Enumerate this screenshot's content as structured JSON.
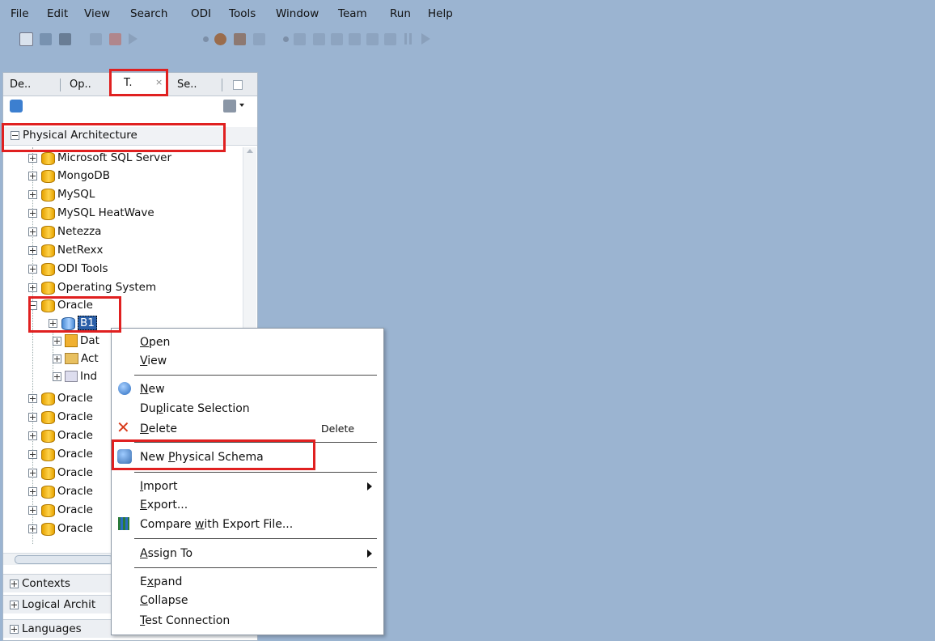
{
  "menubar": [
    "File",
    "Edit",
    "View",
    "Search",
    "ODI",
    "Tools",
    "Window",
    "Team",
    "Run",
    "Help"
  ],
  "navigator": {
    "tabs": [
      "De..",
      "Op..",
      "T.",
      "Se.."
    ],
    "active_tab_close": "×",
    "root": "Physical Architecture",
    "tree": [
      "Microsoft SQL Server",
      "MongoDB",
      "MySQL",
      "MySQL HeatWave",
      "Netezza",
      "NetRexx",
      "ODI Tools",
      "Operating System",
      "Oracle"
    ],
    "oracle_children": {
      "server": "B1",
      "sub": [
        "Dat",
        "Act",
        "Ind"
      ]
    },
    "oracle_siblings": [
      "Oracle",
      "Oracle",
      "Oracle",
      "Oracle",
      "Oracle",
      "Oracle",
      "Oracle",
      "Oracle"
    ],
    "accordion": [
      "Contexts",
      "Logical Archit",
      "Languages"
    ]
  },
  "context_menu": {
    "open": "Open",
    "view": "View",
    "new": "New",
    "duplicate": "Duplicate Selection",
    "delete": "Delete",
    "delete_shortcut": "Delete",
    "new_physical_schema": "New Physical Schema",
    "import": "Import",
    "export": "Export...",
    "compare": "Compare with Export File...",
    "assign_to": "Assign To",
    "expand": "Expand",
    "collapse": "Collapse",
    "test_connection": "Test Connection"
  },
  "colors": {
    "background": "#9bb4d1",
    "highlight": "#e02020",
    "selection": "#2a5fa8"
  }
}
